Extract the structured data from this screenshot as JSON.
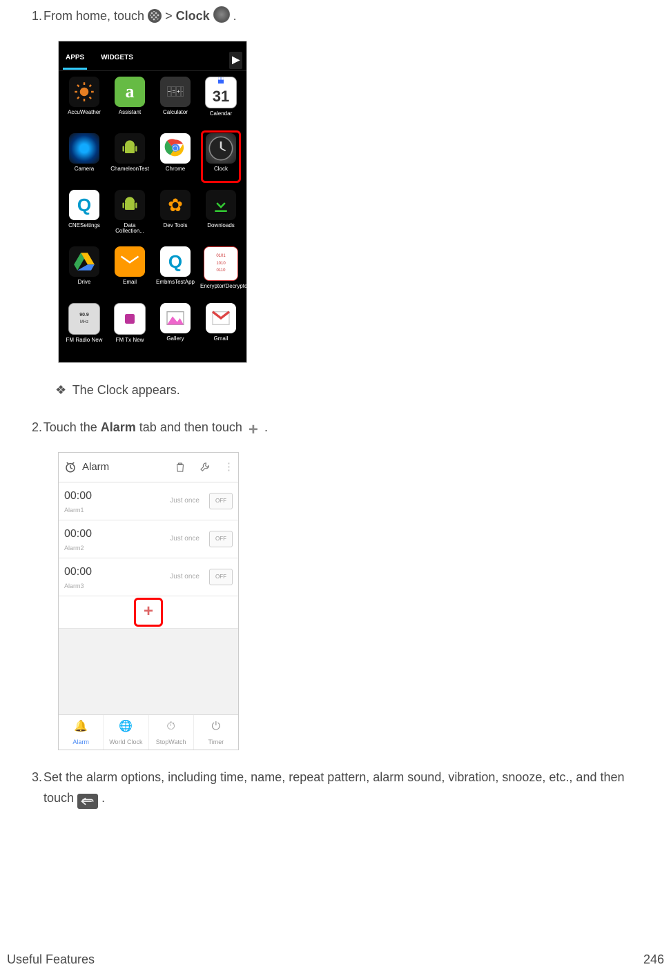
{
  "steps": {
    "s1": {
      "num": "1.",
      "t1": "From home, touch ",
      "t2": " > ",
      "clock_label": "Clock",
      "t3": "."
    },
    "bullet": "The Clock appears.",
    "s2": {
      "num": "2.",
      "t1": "Touch the ",
      "alarm_label": "Alarm",
      "t2": " tab and then touch ",
      "t3": "."
    },
    "s3": {
      "num": "3.",
      "t1": "Set the alarm options, including time, name, repeat pattern, alarm sound, vibration, snooze, etc., and then touch ",
      "t2": "."
    }
  },
  "apps_screen": {
    "tab_apps": "APPS",
    "tab_widgets": "WIDGETS",
    "grid": [
      {
        "label": "AccuWeather"
      },
      {
        "label": "Assistant"
      },
      {
        "label": "Calculator"
      },
      {
        "label": "Calendar"
      },
      {
        "label": "Camera"
      },
      {
        "label": "ChameleonTest"
      },
      {
        "label": "Chrome"
      },
      {
        "label": "Clock"
      },
      {
        "label": "CNESettings"
      },
      {
        "label": "Data Collection..."
      },
      {
        "label": "Dev Tools"
      },
      {
        "label": "Downloads"
      },
      {
        "label": "Drive"
      },
      {
        "label": "Email"
      },
      {
        "label": "EmbmsTestApp"
      },
      {
        "label": "Encryptor/Decryptor"
      },
      {
        "label": "FM Radio New"
      },
      {
        "label": "FM Tx New"
      },
      {
        "label": "Gallery"
      },
      {
        "label": "Gmail"
      }
    ],
    "cal_day": "31"
  },
  "alarm_screen": {
    "title": "Alarm",
    "rows": [
      {
        "time": "00:00",
        "name": "Alarm1",
        "repeat": "Just once",
        "state": "OFF"
      },
      {
        "time": "00:00",
        "name": "Alarm2",
        "repeat": "Just once",
        "state": "OFF"
      },
      {
        "time": "00:00",
        "name": "Alarm3",
        "repeat": "Just once",
        "state": "OFF"
      }
    ],
    "add": "+",
    "tabs": [
      {
        "label": "Alarm"
      },
      {
        "label": "World Clock"
      },
      {
        "label": "StopWatch"
      },
      {
        "label": "Timer"
      }
    ]
  },
  "footer": {
    "section": "Useful Features",
    "page": "246"
  }
}
